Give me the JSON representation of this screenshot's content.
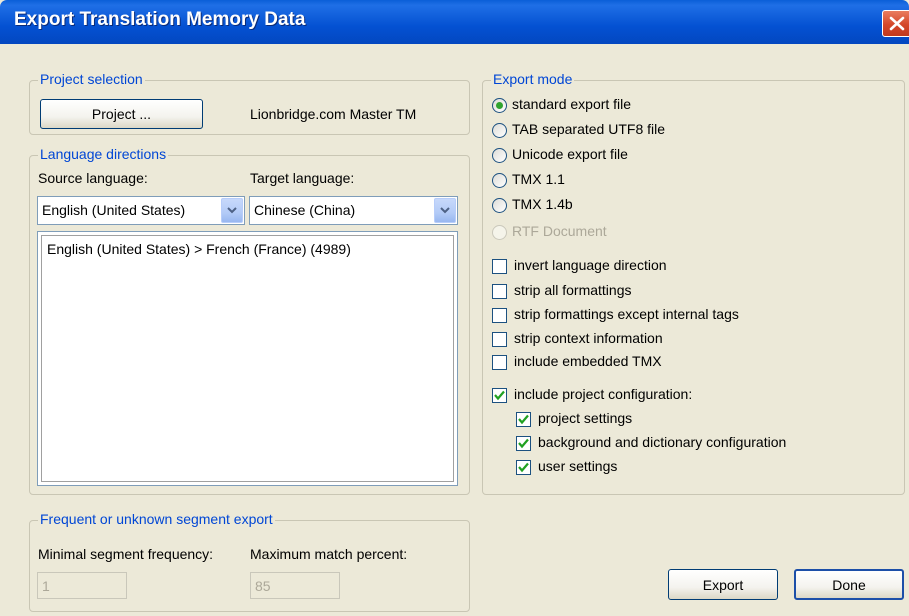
{
  "window": {
    "title": "Export Translation Memory Data"
  },
  "project_selection": {
    "legend": "Project selection",
    "project_button": "Project ...",
    "project_name": "Lionbridge.com Master TM"
  },
  "language_directions": {
    "legend": "Language directions",
    "source_label": "Source language:",
    "target_label": "Target language:",
    "source_value": "English (United States)",
    "target_value": "Chinese (China)",
    "list_items": [
      "English (United States) > French (France) (4989)"
    ]
  },
  "export_mode": {
    "legend": "Export mode",
    "radios": [
      {
        "label": "standard export file",
        "checked": true,
        "disabled": false
      },
      {
        "label": "TAB separated UTF8 file",
        "checked": false,
        "disabled": false
      },
      {
        "label": "Unicode export file",
        "checked": false,
        "disabled": false
      },
      {
        "label": "TMX 1.1",
        "checked": false,
        "disabled": false
      },
      {
        "label": "TMX 1.4b",
        "checked": false,
        "disabled": false
      },
      {
        "label": "RTF Document",
        "checked": false,
        "disabled": true
      }
    ],
    "checkboxes": [
      {
        "label": "invert language direction",
        "checked": false
      },
      {
        "label": "strip all formattings",
        "checked": false
      },
      {
        "label": "strip formattings except internal tags",
        "checked": false
      },
      {
        "label": "strip context information",
        "checked": false
      },
      {
        "label": "include embedded TMX",
        "checked": false
      },
      {
        "label": "include project configuration:",
        "checked": true
      }
    ],
    "sub_checkboxes": [
      {
        "label": "project settings",
        "checked": true
      },
      {
        "label": "background and dictionary configuration",
        "checked": true
      },
      {
        "label": "user settings",
        "checked": true
      }
    ]
  },
  "segment_export": {
    "legend": "Frequent or unknown segment export",
    "min_freq_label": "Minimal segment frequency:",
    "max_match_label": "Maximum match percent:",
    "min_freq_value": "1",
    "max_match_value": "85"
  },
  "buttons": {
    "export": "Export",
    "done": "Done"
  },
  "colors": {
    "title_bar": "#0451d2",
    "dialog_bg": "#ece9d8",
    "legend_text": "#0046d5",
    "radio_dot": "#2fa32f",
    "check_mark": "#21a121",
    "close_button": "#d4472a"
  }
}
